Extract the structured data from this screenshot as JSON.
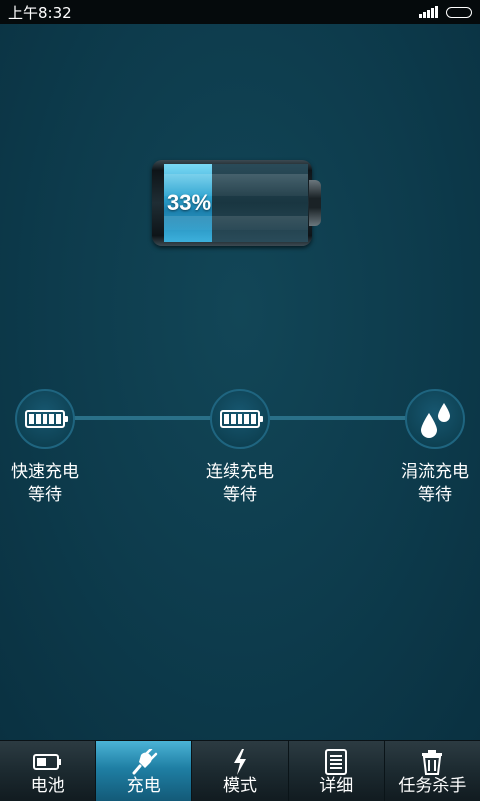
{
  "status_bar": {
    "time": "上午8:32"
  },
  "battery": {
    "percent_label": "33%",
    "level": 0.33,
    "fill_color": "#2fa6d2"
  },
  "stages": [
    {
      "title": "快速充电",
      "status": "等待",
      "icon": "battery-full-icon"
    },
    {
      "title": "连续充电",
      "status": "等待",
      "icon": "battery-full-icon"
    },
    {
      "title": "涓流充电",
      "status": "等待",
      "icon": "water-drops-icon"
    }
  ],
  "nav": {
    "active_index": 1,
    "tabs": [
      {
        "label": "电池",
        "icon": "battery-icon"
      },
      {
        "label": "充电",
        "icon": "plug-icon"
      },
      {
        "label": "模式",
        "icon": "lightning-icon"
      },
      {
        "label": "详细",
        "icon": "document-icon"
      },
      {
        "label": "任务杀手",
        "icon": "trash-icon"
      }
    ]
  },
  "colors": {
    "background": "#0c3a4b",
    "accent": "#2fa6d2",
    "status_bar": "#050a0c"
  }
}
